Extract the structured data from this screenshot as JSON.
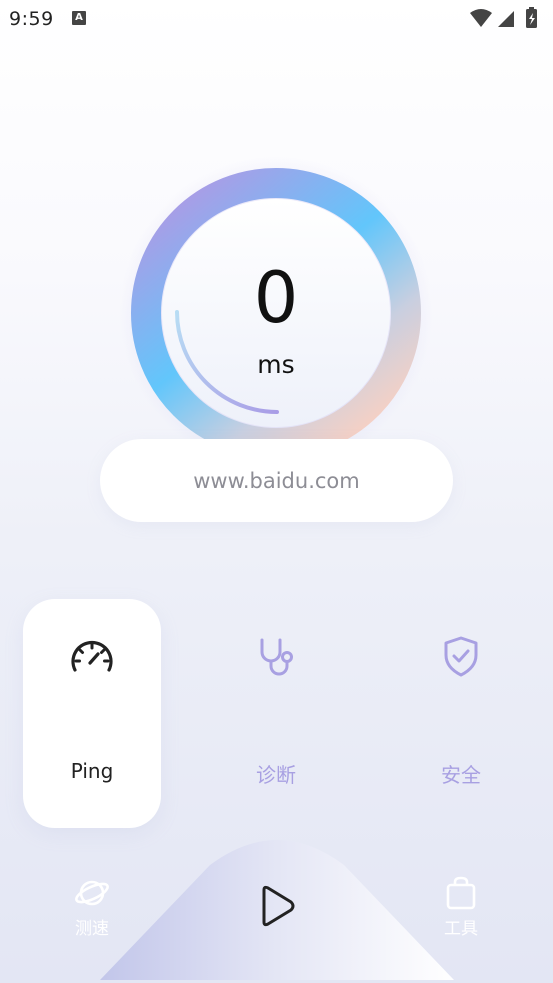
{
  "status_bar": {
    "time": "9:59",
    "notif_letter": "A"
  },
  "gauge": {
    "value": "0",
    "unit": "ms",
    "progress_fraction": 0.12
  },
  "target": {
    "url": "www.baidu.com"
  },
  "modes": [
    {
      "label": "Ping",
      "icon": "speedometer-icon",
      "selected": true
    },
    {
      "label": "诊断",
      "icon": "stethoscope-icon",
      "selected": false
    },
    {
      "label": "安全",
      "icon": "shield-check-icon",
      "selected": false
    }
  ],
  "bottom_nav": {
    "speed_label": "测速",
    "speed_icon": "planet-icon",
    "play_icon": "play-icon",
    "tools_label": "工具",
    "tools_icon": "bag-icon"
  },
  "colors": {
    "accent": "#a8a0e2",
    "ring_blue": "#62c6fb",
    "ring_purple": "#a99de6",
    "ring_peach": "#f6d0c4"
  }
}
